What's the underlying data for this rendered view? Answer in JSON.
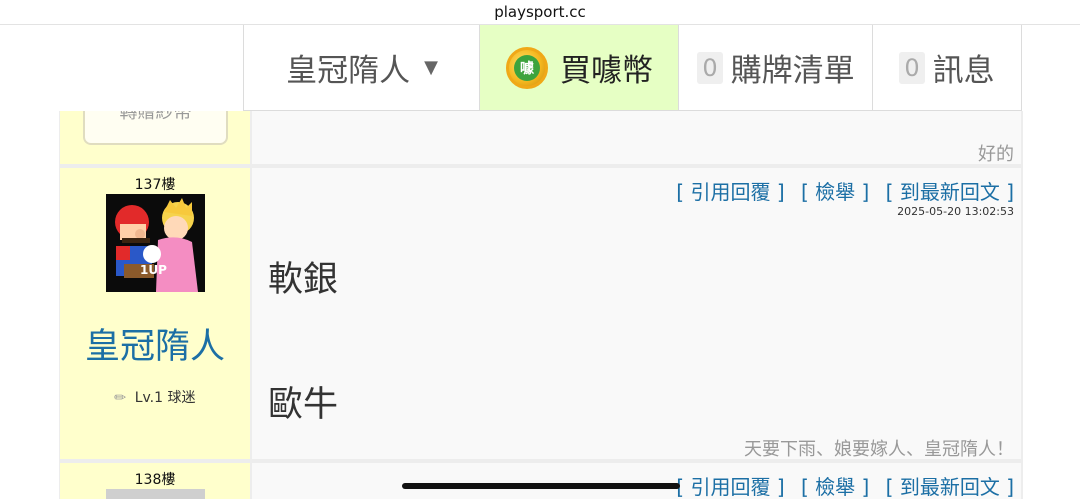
{
  "browser": {
    "url": "playsport.cc"
  },
  "nav": {
    "user": "皇冠隋人",
    "buy_coins": "買噱幣",
    "coin_icon_text": "噱",
    "cart_count": "0",
    "cart_label": "購牌清單",
    "msg_count": "0",
    "msg_label": "訊息"
  },
  "prev_post": {
    "sign_button_partial": "轉贈紗幣",
    "tail_text": "好的"
  },
  "post": {
    "floor": "137樓",
    "username": "皇冠隋人",
    "level": "Lv.1 球迷",
    "actions": {
      "quote": "[ 引用回覆 ]",
      "report": "[ 檢舉 ]",
      "latest": "[ 到最新回文 ]"
    },
    "time": "2025-05-20 13:02:53",
    "lines": [
      "軟銀",
      "歐牛"
    ],
    "signature": "天要下雨、娘要嫁人、皇冠隋人！"
  },
  "next_post": {
    "floor": "138樓",
    "actions": {
      "quote": "[ 引用回覆 ]",
      "report": "[ 檢舉 ]",
      "latest": "[ 到最新回文 ]"
    }
  }
}
